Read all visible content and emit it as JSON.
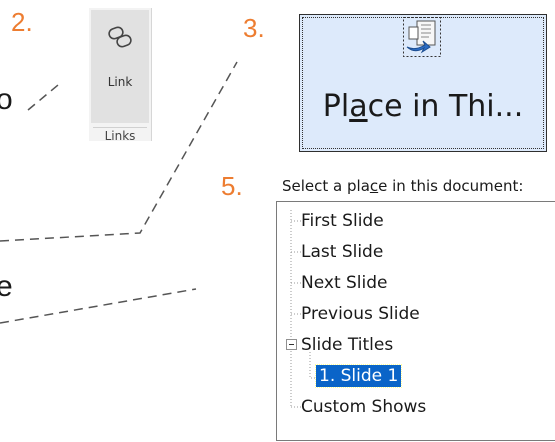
{
  "steps": {
    "s2": "2.",
    "s3": "3.",
    "s5": "5."
  },
  "cut_text": {
    "line1_tail": "o",
    "line2_tail": "e"
  },
  "ribbon": {
    "link_label": "Link",
    "group_label": "Links"
  },
  "place_button": {
    "pre": "Pl",
    "access_key": "a",
    "post": "ce in Thi..."
  },
  "doc_panel": {
    "caption_pre": "Select a pla",
    "caption_key": "c",
    "caption_post": "e in this document:",
    "items": [
      "First Slide",
      "Last Slide",
      "Next Slide",
      "Previous Slide",
      "Slide Titles",
      "1. Slide 1",
      "Custom Shows"
    ]
  },
  "colors": {
    "step_accent": "#ed7d31",
    "selection": "#0a64c8",
    "button_bg": "#ddeafb"
  },
  "icons": {
    "link": "link-chain-icon",
    "place": "document-link-icon",
    "tree_toggle": "minus-box-icon"
  }
}
